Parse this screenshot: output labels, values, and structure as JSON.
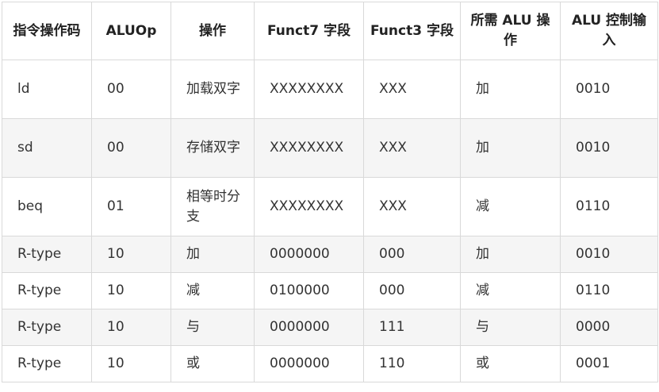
{
  "headers": [
    "指令操作码",
    "ALUOp",
    "操作",
    "Funct7 字段",
    "Funct3 字段",
    "所需 ALU 操作",
    "ALU 控制输入"
  ],
  "rows": [
    [
      "ld",
      "00",
      "加载双字",
      "XXXXXXXX",
      "XXX",
      "加",
      "0010"
    ],
    [
      "sd",
      "00",
      "存储双字",
      "XXXXXXXX",
      "XXX",
      "加",
      "0010"
    ],
    [
      "beq",
      "01",
      "相等时分支",
      "XXXXXXXX",
      "XXX",
      "减",
      "0110"
    ],
    [
      "R-type",
      "10",
      "加",
      "0000000",
      "000",
      "加",
      "0010"
    ],
    [
      "R-type",
      "10",
      "减",
      "0100000",
      "000",
      "减",
      "0110"
    ],
    [
      "R-type",
      "10",
      "与",
      "0000000",
      "111",
      "与",
      "0000"
    ],
    [
      "R-type",
      "10",
      "或",
      "0000000",
      "110",
      "或",
      "0001"
    ]
  ]
}
